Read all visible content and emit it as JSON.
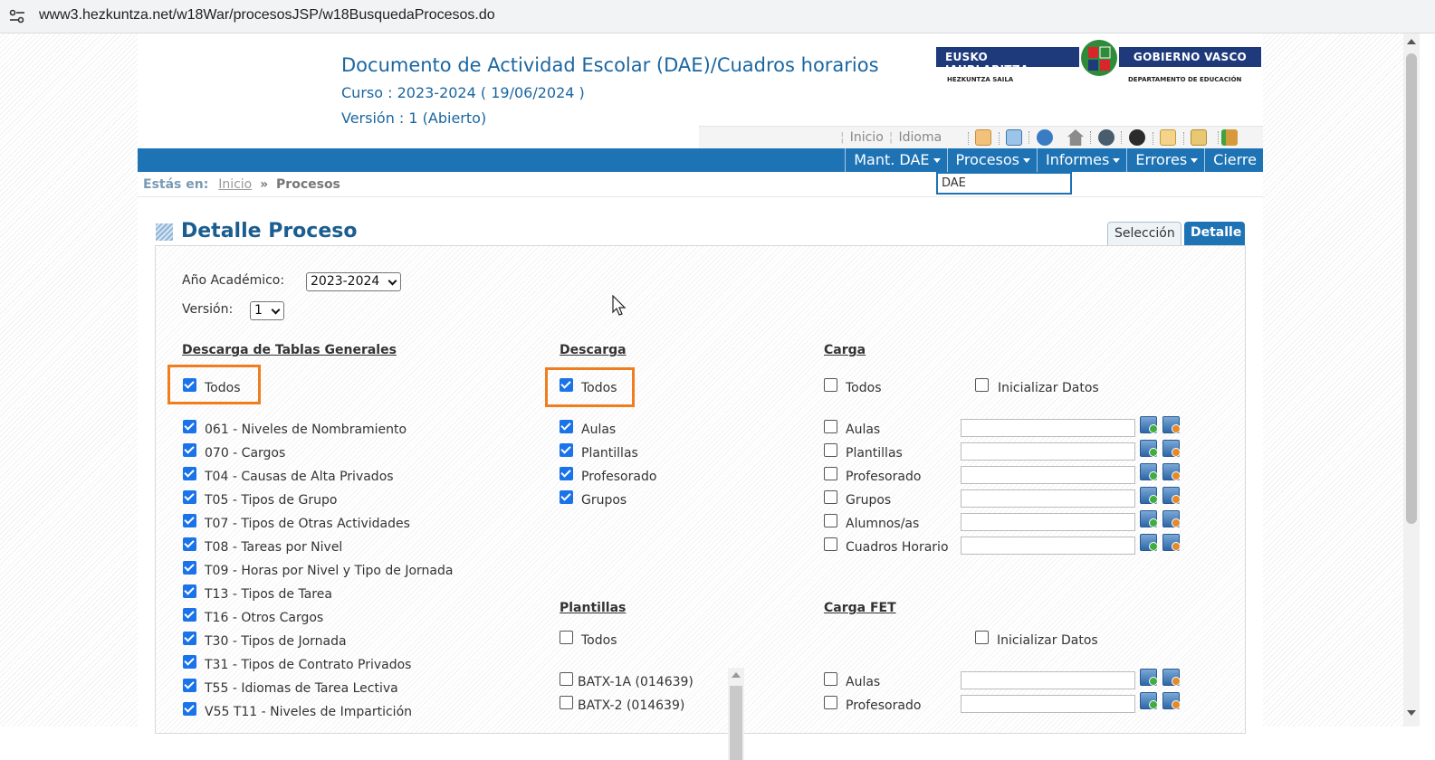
{
  "browser": {
    "url": "www3.hezkuntza.net/w18War/procesosJSP/w18BusquedaProcesos.do"
  },
  "header": {
    "title": "Documento de Actividad Escolar (DAE)/Cuadros horarios",
    "curso": "Curso : 2023-2024 ( 19/06/2024 )",
    "version": "Versión : 1 (Abierto)"
  },
  "logo": {
    "left": "EUSKO JAURLARITZA",
    "right": "GOBIERNO VASCO",
    "left_sub": "HEZKUNTZA SAILA",
    "right_sub": "DEPARTAMENTO DE EDUCACIÓN"
  },
  "toolbar": {
    "inicio": "Inicio",
    "idioma": "Idioma"
  },
  "nav": {
    "items": [
      "Mant. DAE",
      "Procesos",
      "Informes",
      "Errores",
      "Cierre"
    ],
    "dropdown_item": "DAE"
  },
  "breadcrumb": {
    "label": "Estás en:",
    "link": "Inicio",
    "separator": "»",
    "current": "Procesos"
  },
  "section": {
    "title": "Detalle Proceso"
  },
  "tabs": {
    "seleccion": "Selección",
    "detalle": "Detalle"
  },
  "form": {
    "anio_label": "Año Académico:",
    "anio_value": "2023-2024",
    "version_label": "Versión:",
    "version_value": "1"
  },
  "descarga_tablas": {
    "heading": "Descarga de Tablas Generales",
    "todos": "Todos",
    "items": [
      "061 - Niveles de Nombramiento",
      "070 - Cargos",
      "T04 - Causas de Alta Privados",
      "T05 - Tipos de Grupo",
      "T07 - Tipos de Otras Actividades",
      "T08 - Tareas por Nivel",
      "T09 - Horas por Nivel y Tipo de Jornada",
      "T13 - Tipos de Tarea",
      "T16 - Otros Cargos",
      "T30 - Tipos de Jornada",
      "T31 - Tipos de Contrato Privados",
      "T55 - Idiomas de Tarea Lectiva",
      "V55 T11 - Niveles de Impartición"
    ]
  },
  "descarga": {
    "heading": "Descarga",
    "todos": "Todos",
    "items": [
      "Aulas",
      "Plantillas",
      "Profesorado",
      "Grupos"
    ]
  },
  "carga": {
    "heading": "Carga",
    "todos": "Todos",
    "inicializar": "Inicializar Datos",
    "items": [
      "Aulas",
      "Plantillas",
      "Profesorado",
      "Grupos",
      "Alumnos/as",
      "Cuadros Horario"
    ]
  },
  "plantillas": {
    "heading": "Plantillas",
    "todos": "Todos",
    "items": [
      "BATX-1A (014639)",
      "BATX-2 (014639)"
    ]
  },
  "carga_fet": {
    "heading": "Carga FET",
    "inicializar": "Inicializar Datos",
    "items": [
      "Aulas",
      "Profesorado"
    ]
  }
}
